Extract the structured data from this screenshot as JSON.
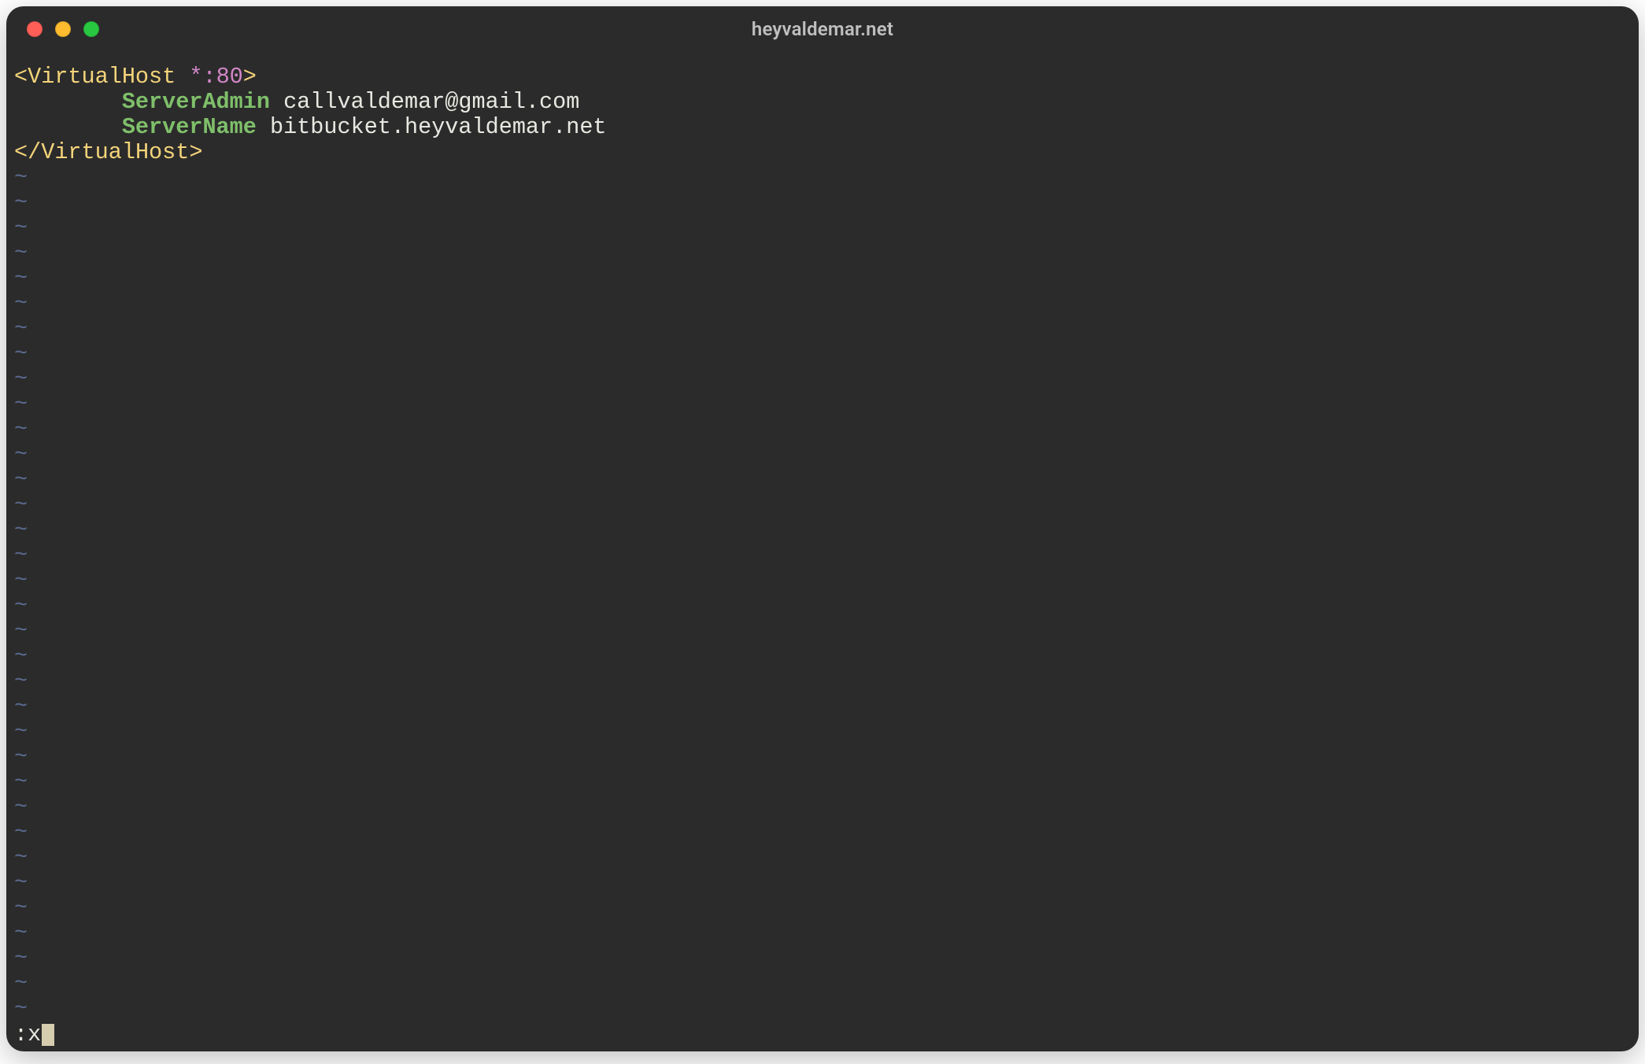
{
  "window": {
    "title": "heyvaldemar.net"
  },
  "editor": {
    "line1": {
      "lt": "<",
      "tag": "VirtualHost",
      "space": " ",
      "attr": "*:80",
      "gt": ">"
    },
    "line2": {
      "indent": "        ",
      "directive": "ServerAdmin",
      "space": " ",
      "value": "callvaldemar@gmail.com"
    },
    "line3": {
      "indent": "        ",
      "directive": "ServerName",
      "space": " ",
      "value": "bitbucket.heyvaldemar.net"
    },
    "line4": {
      "lt": "<",
      "slash": "/",
      "tag": "VirtualHost",
      "gt": ">"
    },
    "tilde": "~",
    "tilde_count": 34
  },
  "command": {
    "prefix": ":",
    "text": "x"
  }
}
